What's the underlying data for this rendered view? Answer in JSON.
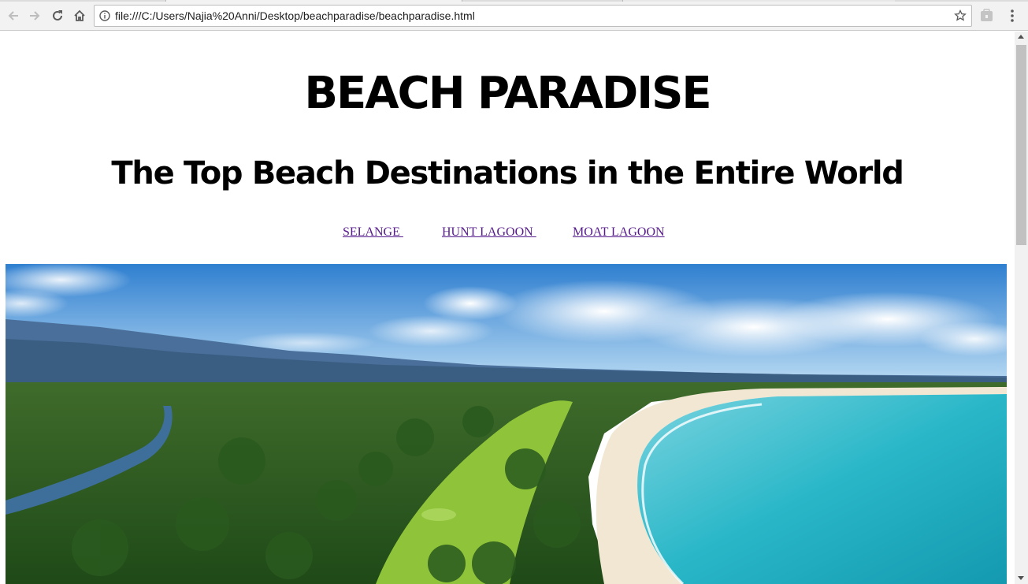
{
  "browser": {
    "url": "file:///C:/Users/Najia%20Anni/Desktop/beachparadise/beachparadise.html",
    "icons": [
      "back-icon",
      "forward-icon",
      "reload-icon",
      "home-icon",
      "info-icon",
      "star-icon",
      "extension-icon",
      "menu-icon"
    ]
  },
  "page": {
    "title": "BEACH PARADISE",
    "subtitle": "The Top Beach Destinations in the Entire World",
    "nav_links": [
      {
        "label": "SELANGE "
      },
      {
        "label": "HUNT LAGOON "
      },
      {
        "label": "MOAT LAGOON"
      }
    ],
    "hero_image": "aerial-beach-photo",
    "link_color": "#551a8b"
  }
}
